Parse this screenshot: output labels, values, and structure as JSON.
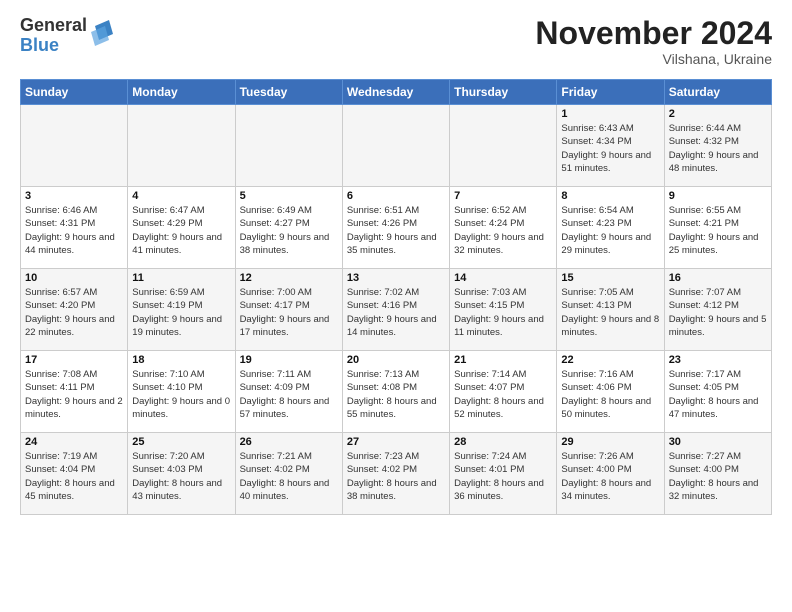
{
  "header": {
    "logo_general": "General",
    "logo_blue": "Blue",
    "month_title": "November 2024",
    "location": "Vilshana, Ukraine"
  },
  "weekdays": [
    "Sunday",
    "Monday",
    "Tuesday",
    "Wednesday",
    "Thursday",
    "Friday",
    "Saturday"
  ],
  "weeks": [
    [
      {
        "day": "",
        "info": ""
      },
      {
        "day": "",
        "info": ""
      },
      {
        "day": "",
        "info": ""
      },
      {
        "day": "",
        "info": ""
      },
      {
        "day": "",
        "info": ""
      },
      {
        "day": "1",
        "info": "Sunrise: 6:43 AM\nSunset: 4:34 PM\nDaylight: 9 hours\nand 51 minutes."
      },
      {
        "day": "2",
        "info": "Sunrise: 6:44 AM\nSunset: 4:32 PM\nDaylight: 9 hours\nand 48 minutes."
      }
    ],
    [
      {
        "day": "3",
        "info": "Sunrise: 6:46 AM\nSunset: 4:31 PM\nDaylight: 9 hours\nand 44 minutes."
      },
      {
        "day": "4",
        "info": "Sunrise: 6:47 AM\nSunset: 4:29 PM\nDaylight: 9 hours\nand 41 minutes."
      },
      {
        "day": "5",
        "info": "Sunrise: 6:49 AM\nSunset: 4:27 PM\nDaylight: 9 hours\nand 38 minutes."
      },
      {
        "day": "6",
        "info": "Sunrise: 6:51 AM\nSunset: 4:26 PM\nDaylight: 9 hours\nand 35 minutes."
      },
      {
        "day": "7",
        "info": "Sunrise: 6:52 AM\nSunset: 4:24 PM\nDaylight: 9 hours\nand 32 minutes."
      },
      {
        "day": "8",
        "info": "Sunrise: 6:54 AM\nSunset: 4:23 PM\nDaylight: 9 hours\nand 29 minutes."
      },
      {
        "day": "9",
        "info": "Sunrise: 6:55 AM\nSunset: 4:21 PM\nDaylight: 9 hours\nand 25 minutes."
      }
    ],
    [
      {
        "day": "10",
        "info": "Sunrise: 6:57 AM\nSunset: 4:20 PM\nDaylight: 9 hours\nand 22 minutes."
      },
      {
        "day": "11",
        "info": "Sunrise: 6:59 AM\nSunset: 4:19 PM\nDaylight: 9 hours\nand 19 minutes."
      },
      {
        "day": "12",
        "info": "Sunrise: 7:00 AM\nSunset: 4:17 PM\nDaylight: 9 hours\nand 17 minutes."
      },
      {
        "day": "13",
        "info": "Sunrise: 7:02 AM\nSunset: 4:16 PM\nDaylight: 9 hours\nand 14 minutes."
      },
      {
        "day": "14",
        "info": "Sunrise: 7:03 AM\nSunset: 4:15 PM\nDaylight: 9 hours\nand 11 minutes."
      },
      {
        "day": "15",
        "info": "Sunrise: 7:05 AM\nSunset: 4:13 PM\nDaylight: 9 hours\nand 8 minutes."
      },
      {
        "day": "16",
        "info": "Sunrise: 7:07 AM\nSunset: 4:12 PM\nDaylight: 9 hours\nand 5 minutes."
      }
    ],
    [
      {
        "day": "17",
        "info": "Sunrise: 7:08 AM\nSunset: 4:11 PM\nDaylight: 9 hours\nand 2 minutes."
      },
      {
        "day": "18",
        "info": "Sunrise: 7:10 AM\nSunset: 4:10 PM\nDaylight: 9 hours\nand 0 minutes."
      },
      {
        "day": "19",
        "info": "Sunrise: 7:11 AM\nSunset: 4:09 PM\nDaylight: 8 hours\nand 57 minutes."
      },
      {
        "day": "20",
        "info": "Sunrise: 7:13 AM\nSunset: 4:08 PM\nDaylight: 8 hours\nand 55 minutes."
      },
      {
        "day": "21",
        "info": "Sunrise: 7:14 AM\nSunset: 4:07 PM\nDaylight: 8 hours\nand 52 minutes."
      },
      {
        "day": "22",
        "info": "Sunrise: 7:16 AM\nSunset: 4:06 PM\nDaylight: 8 hours\nand 50 minutes."
      },
      {
        "day": "23",
        "info": "Sunrise: 7:17 AM\nSunset: 4:05 PM\nDaylight: 8 hours\nand 47 minutes."
      }
    ],
    [
      {
        "day": "24",
        "info": "Sunrise: 7:19 AM\nSunset: 4:04 PM\nDaylight: 8 hours\nand 45 minutes."
      },
      {
        "day": "25",
        "info": "Sunrise: 7:20 AM\nSunset: 4:03 PM\nDaylight: 8 hours\nand 43 minutes."
      },
      {
        "day": "26",
        "info": "Sunrise: 7:21 AM\nSunset: 4:02 PM\nDaylight: 8 hours\nand 40 minutes."
      },
      {
        "day": "27",
        "info": "Sunrise: 7:23 AM\nSunset: 4:02 PM\nDaylight: 8 hours\nand 38 minutes."
      },
      {
        "day": "28",
        "info": "Sunrise: 7:24 AM\nSunset: 4:01 PM\nDaylight: 8 hours\nand 36 minutes."
      },
      {
        "day": "29",
        "info": "Sunrise: 7:26 AM\nSunset: 4:00 PM\nDaylight: 8 hours\nand 34 minutes."
      },
      {
        "day": "30",
        "info": "Sunrise: 7:27 AM\nSunset: 4:00 PM\nDaylight: 8 hours\nand 32 minutes."
      }
    ]
  ]
}
